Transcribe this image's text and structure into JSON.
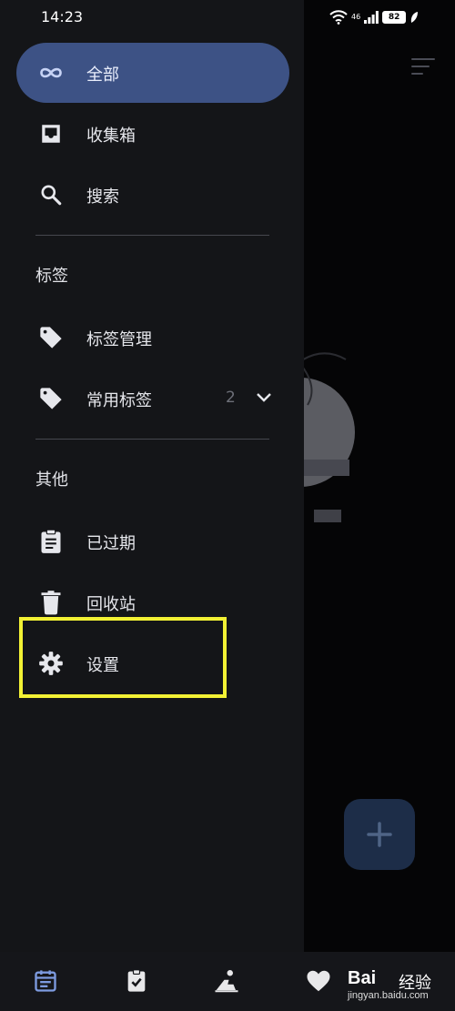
{
  "status_bar": {
    "time": "14:23",
    "network": "46",
    "battery": "82"
  },
  "drawer": {
    "items": [
      {
        "label": "全部",
        "icon": "infinity-icon",
        "active": true
      },
      {
        "label": "收集箱",
        "icon": "inbox-icon"
      },
      {
        "label": "搜索",
        "icon": "search-icon"
      }
    ],
    "tags_section": {
      "header": "标签",
      "items": [
        {
          "label": "标签管理",
          "icon": "tag-icon"
        },
        {
          "label": "常用标签",
          "icon": "tag-icon",
          "count": "2",
          "expand_icon": "chevron-down-icon"
        }
      ]
    },
    "other_section": {
      "header": "其他",
      "items": [
        {
          "label": "已过期",
          "icon": "clipboard-icon"
        },
        {
          "label": "回收站",
          "icon": "trash-icon"
        },
        {
          "label": "设置",
          "icon": "gear-icon",
          "highlighted": true
        }
      ]
    }
  },
  "highlight_color": "#f2f134",
  "accent_color": "#3d5285",
  "bottom_nav": {
    "items": [
      {
        "icon": "calendar-icon",
        "active": true
      },
      {
        "icon": "task-check-icon"
      },
      {
        "icon": "meditation-icon"
      },
      {
        "icon": "heart-icon"
      }
    ]
  },
  "watermark": {
    "brand": "Bai",
    "brand_ext": "经验",
    "sub": "jingyan.baidu.com"
  }
}
